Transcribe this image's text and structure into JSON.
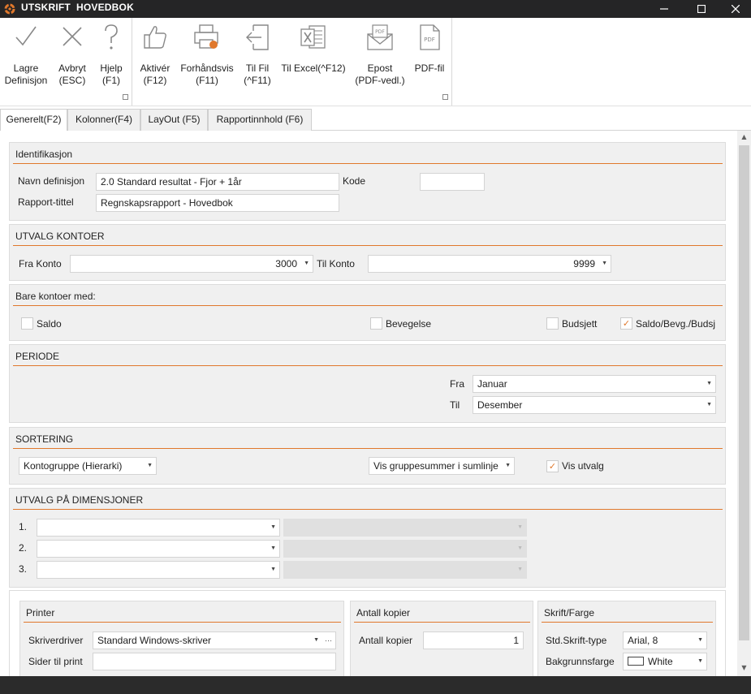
{
  "window": {
    "title": "UTSKRIFT  HOVEDBOK"
  },
  "ribbon": {
    "save": "Lagre\nDefinisjon",
    "cancel": "Avbryt\n(ESC)",
    "help": "Hjelp\n(F1)",
    "activate": "Aktivér\n(F12)",
    "preview": "Forhåndsvis\n(F11)",
    "to_file": "Til Fil\n(^F11)",
    "to_excel": "Til Excel(^F12)",
    "email": "Epost\n(PDF-vedl.)",
    "pdf": "PDF-fil",
    "pdf_icon_text": "PDF",
    "colors": {
      "icon": "#888888",
      "accent": "#e0782c"
    }
  },
  "tabs": [
    {
      "label": "Generelt(F2)",
      "active": true
    },
    {
      "label": "Kolonner(F4)",
      "active": false
    },
    {
      "label": "LayOut (F5)",
      "active": false
    },
    {
      "label": "Rapportinnhold (F6)",
      "active": false
    }
  ],
  "identifikasjon": {
    "header": "Identifikasjon",
    "navn_label": "Navn definisjon",
    "navn_value": "2.0 Standard resultat - Fjor + 1år",
    "kode_label": "Kode",
    "kode_value": "",
    "tittel_label": "Rapport-tittel",
    "tittel_value": "Regnskapsrapport - Hovedbok"
  },
  "utvalg_kontoer": {
    "header": "UTVALG KONTOER",
    "fra_label": "Fra Konto",
    "fra_value": "3000",
    "til_label": "Til Konto",
    "til_value": "9999"
  },
  "bare_kontoer": {
    "header": "Bare kontoer med:",
    "saldo": {
      "label": "Saldo",
      "checked": false
    },
    "bevegelse": {
      "label": "Bevegelse",
      "checked": false
    },
    "budsjett": {
      "label": "Budsjett",
      "checked": false
    },
    "saldo_bevg": {
      "label": "Saldo/Bevg./Budsj",
      "checked": true
    }
  },
  "periode": {
    "header": "PERIODE",
    "fra_label": "Fra",
    "fra_value": "Januar",
    "til_label": "Til",
    "til_value": "Desember"
  },
  "sortering": {
    "header": "SORTERING",
    "sort_value": "Kontogruppe (Hierarki)",
    "grupper_value": "Vis gruppesummer i sumlinje",
    "vis_utvalg": {
      "label": "Vis utvalg",
      "checked": true
    }
  },
  "dimensjoner": {
    "header": "UTVALG PÅ DIMENSJONER",
    "rows": [
      {
        "label": "1.",
        "value": "",
        "value2": ""
      },
      {
        "label": "2.",
        "value": "",
        "value2": ""
      },
      {
        "label": "3.",
        "value": "",
        "value2": ""
      }
    ]
  },
  "printer": {
    "header": "Printer",
    "driver_label": "Skriverdriver",
    "driver_value": "Standard Windows-skriver",
    "ellipsis": "···",
    "sider_label": "Sider til print",
    "sider_value": ""
  },
  "kopier": {
    "header": "Antall kopier",
    "label": "Antall kopier",
    "value": "1"
  },
  "skrift": {
    "header": "Skrift/Farge",
    "type_label": "Std.Skrift-type",
    "type_value": "Arial, 8",
    "farge_label": "Bakgrunnsfarge",
    "farge_value": "White",
    "farge_swatch": "#ffffff"
  }
}
